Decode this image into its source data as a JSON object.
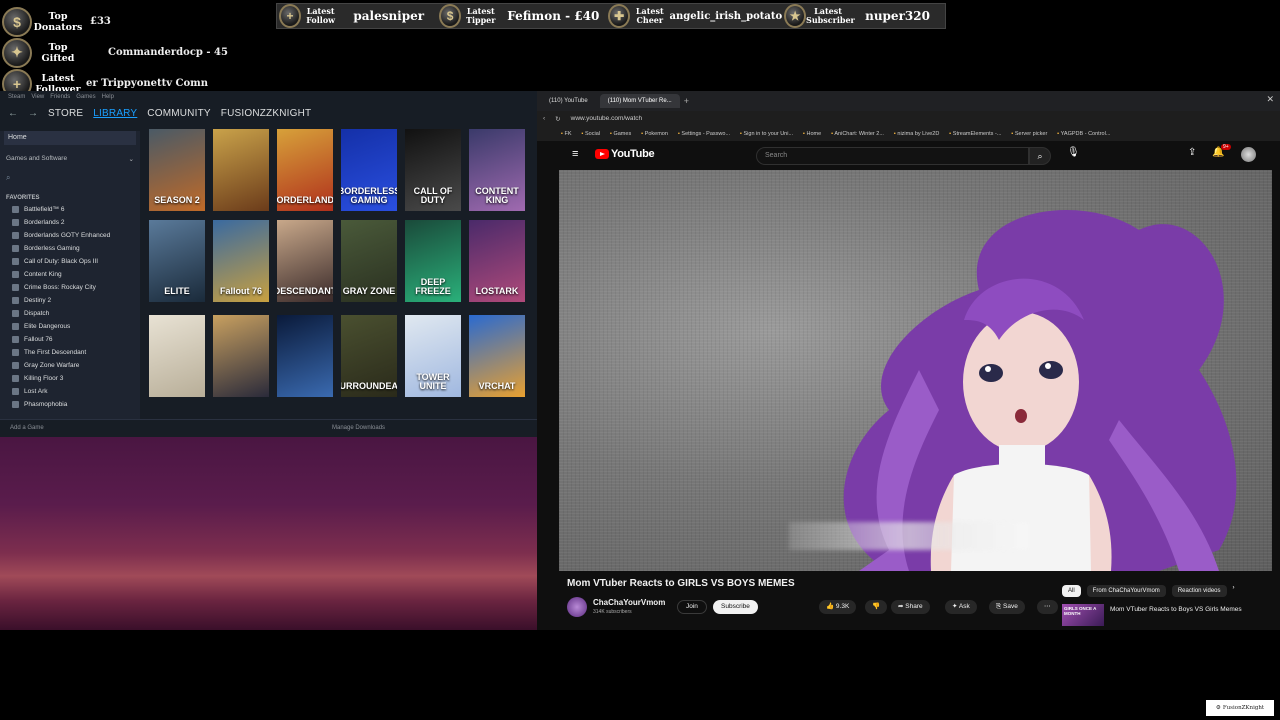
{
  "overlay": {
    "left_widgets": [
      {
        "label": "Top Donators",
        "value": "£33",
        "icon": "coin-icon"
      },
      {
        "label": "Top Gifted",
        "value": "Commanderdocp - 45",
        "icon": "gift-icon"
      },
      {
        "label": "Latest Follower",
        "value": "er  Trippyonettv  Comn",
        "icon": "plus-icon"
      }
    ],
    "top_bar": [
      {
        "label": "Latest Follow",
        "value": "palesniper",
        "icon": "plus-icon"
      },
      {
        "label": "Latest Tipper",
        "value": "Fefimon - £40",
        "icon": "dollar-icon"
      },
      {
        "label": "Latest Cheer",
        "value": "angelic_irish_potato",
        "icon": "cheer-icon"
      },
      {
        "label": "Latest Subscriber",
        "value": "nuper320",
        "icon": "star-icon"
      }
    ]
  },
  "steam": {
    "menubar": [
      "Steam",
      "View",
      "Friends",
      "Games",
      "Help"
    ],
    "nav": {
      "store": "STORE",
      "library": "LIBRARY",
      "community": "COMMUNITY",
      "user": "FUSIONZZKNIGHT"
    },
    "sidebar": {
      "home": "Home",
      "filter": "Games and Software",
      "favorites_header": "FAVORITES",
      "games": [
        "Battlefield™ 6",
        "Borderlands 2",
        "Borderlands GOTY Enhanced",
        "Borderless Gaming",
        "Call of Duty: Black Ops III",
        "Content King",
        "Crime Boss: Rockay City",
        "Destiny 2",
        "Dispatch",
        "Elite Dangerous",
        "Fallout 76",
        "The First Descendant",
        "Gray Zone Warfare",
        "Killing Floor 3",
        "Lost Ark",
        "Phasmophobia"
      ]
    },
    "tiles": [
      {
        "text": "SEASON 2",
        "c1": "#4a5a66",
        "c2": "#c06a28"
      },
      {
        "text": "",
        "c1": "#c9a24a",
        "c2": "#6b3b1a"
      },
      {
        "text": "BORDERLANDS",
        "c1": "#d7a13a",
        "c2": "#b0301c"
      },
      {
        "text": "BORDERLESS GAMING",
        "c1": "#1430a8",
        "c2": "#2a4fe0"
      },
      {
        "text": "CALL OF DUTY",
        "c1": "#111111",
        "c2": "#4a4a4a"
      },
      {
        "text": "CONTENT KING",
        "c1": "#3a3a6a",
        "c2": "#a06ab0"
      },
      {
        "text": "ELITE",
        "c1": "#5a7a9a",
        "c2": "#1a2a3a"
      },
      {
        "text": "Fallout 76",
        "c1": "#3a6aa0",
        "c2": "#c8a040"
      },
      {
        "text": "DESCENDANT",
        "c1": "#c8a88a",
        "c2": "#3a2a2a"
      },
      {
        "text": "GRAY ZONE",
        "c1": "#4a5a3a",
        "c2": "#2a3020"
      },
      {
        "text": "DEEP FREEZE",
        "c1": "#1a4a3a",
        "c2": "#2ab07a"
      },
      {
        "text": "LOSTARK",
        "c1": "#4a2a6a",
        "c2": "#b04a7a"
      },
      {
        "text": "",
        "c1": "#e8e2d4",
        "c2": "#b8ae98"
      },
      {
        "text": "",
        "c1": "#c8a060",
        "c2": "#2a2a3a"
      },
      {
        "text": "",
        "c1": "#0a1a3a",
        "c2": "#3a6ab0"
      },
      {
        "text": "SURROUNDEAD",
        "c1": "#4a5030",
        "c2": "#2a2a1a"
      },
      {
        "text": "TOWER UNITE",
        "c1": "#e0e8f0",
        "c2": "#a0b8e0"
      },
      {
        "text": "VRCHAT",
        "c1": "#2a6ad0",
        "c2": "#e8a030"
      }
    ],
    "bottom": {
      "add_game": "Add a Game",
      "manage_downloads": "Manage Downloads"
    }
  },
  "browser": {
    "tabs": [
      "(110) YouTube",
      "(110) Mom VTuber Re..."
    ],
    "url": "www.youtube.com/watch",
    "bookmarks": [
      "FK",
      "Social",
      "Games",
      "Pokemon",
      "Settings - Passwo...",
      "Sign in to your Uni...",
      "Home",
      "AniChart: Winter 2...",
      "nizima by Live2D",
      "StreamElements -...",
      "Server picker",
      "YAGPDB - Control..."
    ],
    "youtube": {
      "logo": "YouTube",
      "search_placeholder": "Search",
      "notifications": "9+",
      "video_title": "Mom VTuber Reacts to GIRLS VS BOYS MEMES",
      "channel": "ChaChaYourVmom",
      "subscribers": "314K subscribers",
      "join": "Join",
      "subscribe": "Subscribe",
      "likes": "9.3K",
      "share": "Share",
      "ask": "Ask",
      "save": "Save",
      "chips": [
        "All",
        "From ChaChaYourVmom",
        "Reaction videos"
      ],
      "rec_title": "Mom VTuber Reacts to Boys VS Girls Memes",
      "rec_thumb_text": "GIRLS ONCE A MONTH"
    }
  },
  "watermark": "FusionZKnight"
}
